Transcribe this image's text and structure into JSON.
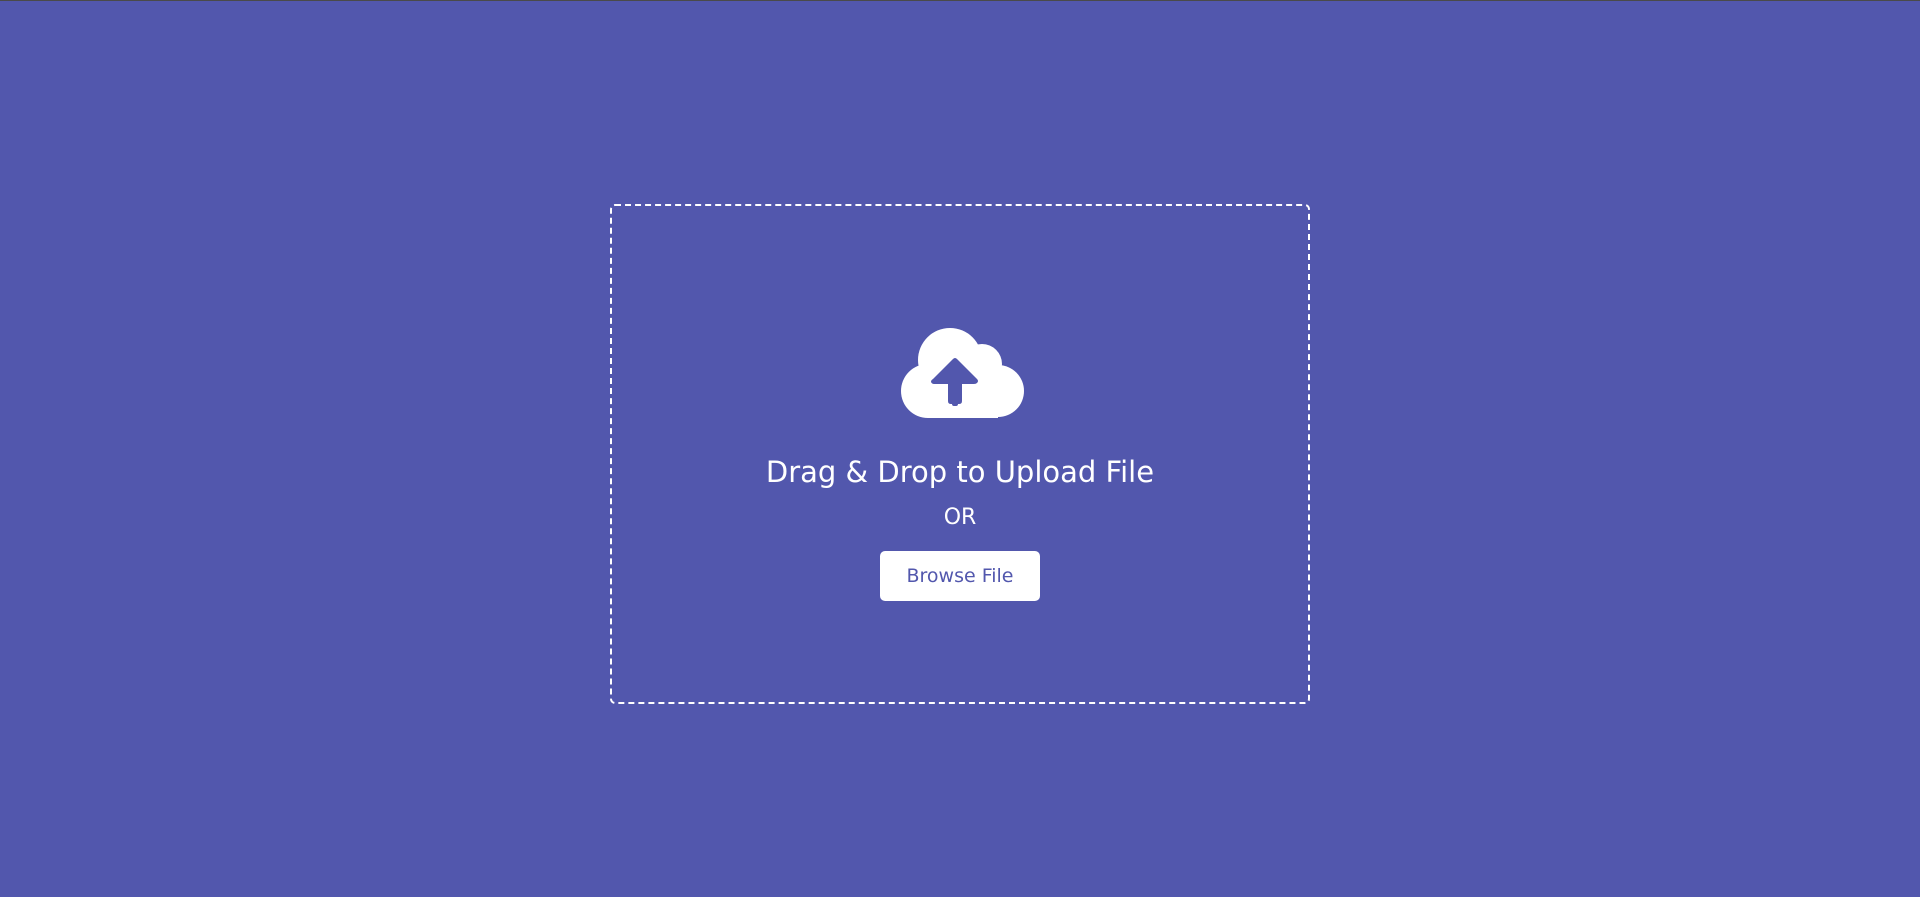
{
  "upload": {
    "icon": "cloud-upload-icon",
    "title": "Drag & Drop to Upload File",
    "separator": "OR",
    "browse_label": "Browse File"
  },
  "colors": {
    "background": "#5257ad",
    "foreground": "#ffffff",
    "accent": "#5257ad"
  }
}
